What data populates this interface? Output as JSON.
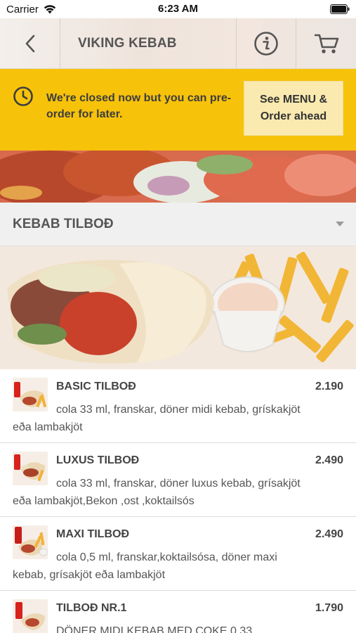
{
  "status_bar": {
    "carrier": "Carrier",
    "time": "6:23 AM"
  },
  "nav": {
    "title": "VIKING KEBAB",
    "back_icon": "chevron-left-icon",
    "info_icon": "info-circle-icon",
    "cart_icon": "cart-icon"
  },
  "notice": {
    "icon": "clock-icon",
    "message": "We're closed now but you can pre-order for later.",
    "button_label": "See MENU & Order ahead",
    "background_color": "#f7c20a"
  },
  "category": {
    "title": "KEBAB TILBOÐ",
    "icon": "caret-down-icon"
  },
  "menu_items": [
    {
      "name": "BASIC TILBOÐ",
      "price": "2.190",
      "description": "cola 33 ml, franskar, döner midi kebab, grískakjöt eða lambakjöt"
    },
    {
      "name": "LUXUS TILBOÐ",
      "price": "2.490",
      "description": "cola 33 ml, franskar, döner luxus kebab, grísakjöt eða lambakjöt,Bekon ,ost ,koktailsós"
    },
    {
      "name": "MAXI TILBOÐ",
      "price": "2.490",
      "description": "cola 0,5 ml, franskar,koktailsósa, döner maxi kebab, grísakjöt eða lambakjöt"
    },
    {
      "name": "TILBOÐ NR.1",
      "price": "1.790",
      "description": "DÖNER MIDI KEBAB MED COKE 0,33"
    }
  ]
}
